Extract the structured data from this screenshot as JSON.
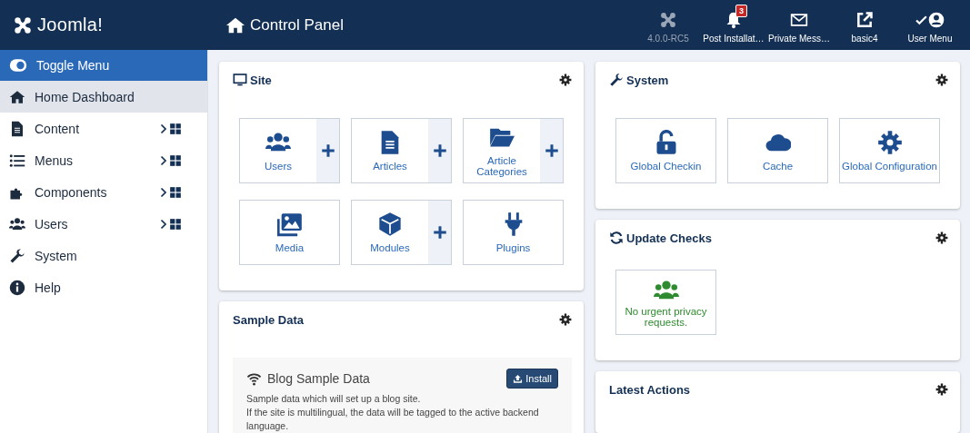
{
  "header": {
    "logo": "Joomla!",
    "title": "Control Panel",
    "items": [
      {
        "label": "4.0.0-RC5",
        "disabled": true
      },
      {
        "label": "Post Installat…",
        "disabled": false,
        "badge": "3"
      },
      {
        "label": "Private Mess…",
        "disabled": false
      },
      {
        "label": "basic4",
        "disabled": false
      },
      {
        "label": "User Menu",
        "disabled": false
      }
    ]
  },
  "sidebar": {
    "toggle": {
      "label": "Toggle Menu",
      "on": true
    },
    "items": [
      {
        "label": "Home Dashboard",
        "selected": true,
        "expandable": false
      },
      {
        "label": "Content",
        "selected": false,
        "expandable": true
      },
      {
        "label": "Menus",
        "selected": false,
        "expandable": true
      },
      {
        "label": "Components",
        "selected": false,
        "expandable": true
      },
      {
        "label": "Users",
        "selected": false,
        "expandable": true
      },
      {
        "label": "System",
        "selected": false,
        "expandable": false
      },
      {
        "label": "Help",
        "selected": false,
        "expandable": false
      }
    ]
  },
  "site": {
    "title": "Site",
    "tiles": [
      {
        "label": "Users",
        "add": true
      },
      {
        "label": "Articles",
        "add": true
      },
      {
        "label": "Article Categories",
        "add": true
      },
      {
        "label": "Media",
        "add": false
      },
      {
        "label": "Modules",
        "add": true
      },
      {
        "label": "Plugins",
        "add": false
      }
    ]
  },
  "sample_data": {
    "title": "Sample Data",
    "item": {
      "title": "Blog Sample Data",
      "button": "Install",
      "description": [
        "Sample data which will set up a blog site.",
        "If the site is multilingual, the data will be tagged to the active backend language."
      ]
    }
  },
  "system": {
    "title": "System",
    "tiles": [
      {
        "label": "Global Checkin",
        "add": false
      },
      {
        "label": "Cache",
        "add": false
      },
      {
        "label": "Global Configuration",
        "add": false
      }
    ]
  },
  "update_checks": {
    "title": "Update Checks",
    "tiles": [
      {
        "label": "No urgent privacy requests.",
        "kind": "success"
      }
    ]
  },
  "latest_actions": {
    "title": "Latest Actions"
  }
}
